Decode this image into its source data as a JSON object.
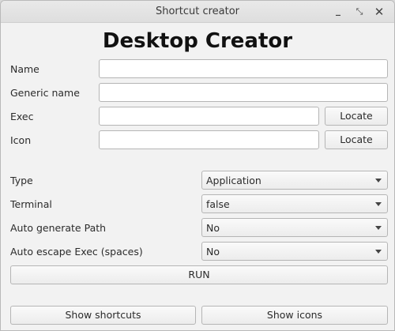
{
  "window": {
    "title": "Shortcut creator"
  },
  "heading": "Desktop Creator",
  "fields": {
    "name": {
      "label": "Name",
      "value": ""
    },
    "generic_name": {
      "label": "Generic name",
      "value": ""
    },
    "exec": {
      "label": "Exec",
      "value": "",
      "locate_label": "Locate"
    },
    "icon": {
      "label": "Icon",
      "value": "",
      "locate_label": "Locate"
    }
  },
  "options": {
    "type": {
      "label": "Type",
      "selected": "Application"
    },
    "terminal": {
      "label": "Terminal",
      "selected": "false"
    },
    "auto_path": {
      "label": "Auto generate Path",
      "selected": "No"
    },
    "auto_escape": {
      "label": "Auto escape Exec (spaces)",
      "selected": "No"
    }
  },
  "buttons": {
    "run": "RUN",
    "show_shortcuts": "Show shortcuts",
    "show_icons": "Show icons"
  },
  "icons": {
    "minimize": "minimize-icon",
    "maximize": "maximize-icon",
    "close": "close-icon",
    "dropdown": "chevron-down-icon"
  }
}
